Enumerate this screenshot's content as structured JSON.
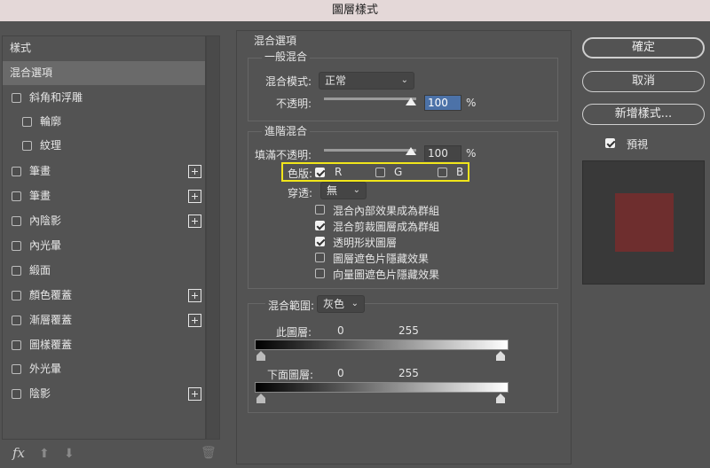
{
  "window": {
    "title": "圖層樣式"
  },
  "style_list": {
    "header": "樣式",
    "selected": "混合選項",
    "items": [
      {
        "label": "斜角和浮雕",
        "checked": false,
        "plus": false
      },
      {
        "label": "輪廓",
        "checked": false,
        "plus": false
      },
      {
        "label": "紋理",
        "checked": false,
        "plus": false
      },
      {
        "label": "筆畫",
        "checked": false,
        "plus": true
      },
      {
        "label": "筆畫",
        "checked": false,
        "plus": true
      },
      {
        "label": "內陰影",
        "checked": false,
        "plus": true
      },
      {
        "label": "內光暈",
        "checked": false,
        "plus": false
      },
      {
        "label": "緞面",
        "checked": false,
        "plus": false
      },
      {
        "label": "顏色覆蓋",
        "checked": false,
        "plus": true
      },
      {
        "label": "漸層覆蓋",
        "checked": false,
        "plus": true
      },
      {
        "label": "圖樣覆蓋",
        "checked": false,
        "plus": false
      },
      {
        "label": "外光暈",
        "checked": false,
        "plus": false
      },
      {
        "label": "陰影",
        "checked": false,
        "plus": true
      }
    ],
    "fx_label": "fx",
    "up_arrow": "⬆",
    "down_arrow": "⬇",
    "trash_icon": "🗑"
  },
  "blending": {
    "section_title": "混合選項",
    "general": {
      "title": "一般混合",
      "mode_label": "混合模式:",
      "mode_value": "正常",
      "opacity_label": "不透明:",
      "opacity_value": "100",
      "opacity_unit": "%"
    },
    "advanced": {
      "title": "進階混合",
      "fill_label": "填滿不透明:",
      "fill_value": "100",
      "fill_unit": "%",
      "channels_label": "色版:",
      "channel_r": "R",
      "channel_g": "G",
      "channel_b": "B",
      "knockout_label": "穿透:",
      "knockout_value": "無",
      "options": [
        {
          "label": "混合內部效果成為群組",
          "checked": false
        },
        {
          "label": "混合剪裁圖層成為群組",
          "checked": true
        },
        {
          "label": "透明形狀圖層",
          "checked": true
        },
        {
          "label": "圖層遮色片隱藏效果",
          "checked": false
        },
        {
          "label": "向量圖遮色片隱藏效果",
          "checked": false
        }
      ]
    },
    "blend_if": {
      "label": "混合範圍:",
      "value": "灰色",
      "this_layer_label": "此圖層:",
      "this_layer_min": "0",
      "this_layer_max": "255",
      "underlying_label": "下面圖層:",
      "underlying_min": "0",
      "underlying_max": "255"
    }
  },
  "buttons": {
    "ok": "確定",
    "cancel": "取消",
    "new_style": "新增樣式...",
    "preview_label": "預視"
  },
  "colors": {
    "swatch": "#6e2e2e",
    "highlight": "#f1e51a"
  }
}
